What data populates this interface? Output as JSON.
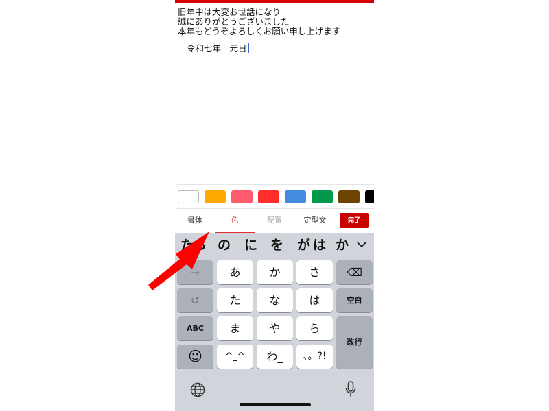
{
  "message": {
    "lines": [
      "旧年中は大変お世話になり",
      "誠にありがとうございました",
      "本年もどうぞよろしくお願い申し上げます"
    ],
    "date": "令和七年　元日"
  },
  "accent": "#d40000",
  "colors": [
    "#ffffff",
    "#ffa800",
    "#ff5a6e",
    "#ff2d2d",
    "#438bdc",
    "#009a4a",
    "#6c4300",
    "#000000"
  ],
  "tabs": [
    {
      "label": "書体"
    },
    {
      "label": "色"
    },
    {
      "label": "配置"
    },
    {
      "label": "定型文"
    }
  ],
  "active_tab": "色",
  "done_label": "完了",
  "candidates": [
    "たら",
    "の",
    "に",
    "を",
    "が",
    "は",
    "か"
  ],
  "keys": {
    "arrow": "→",
    "a": "あ",
    "ka": "か",
    "sa": "さ",
    "backspace": "⌫",
    "undo": "↺",
    "ta": "た",
    "na": "な",
    "ha": "は",
    "space": "空白",
    "abc": "ABC",
    "ma": "ま",
    "ya": "や",
    "ra": "ら",
    "enter": "改行",
    "emoji": "☺",
    "kao": "^_^",
    "wa": "わ_",
    "punct": "、。?!"
  },
  "icons": {
    "globe": "globe-icon",
    "mic": "microphone-icon",
    "collapse": "chevron-down-icon"
  }
}
